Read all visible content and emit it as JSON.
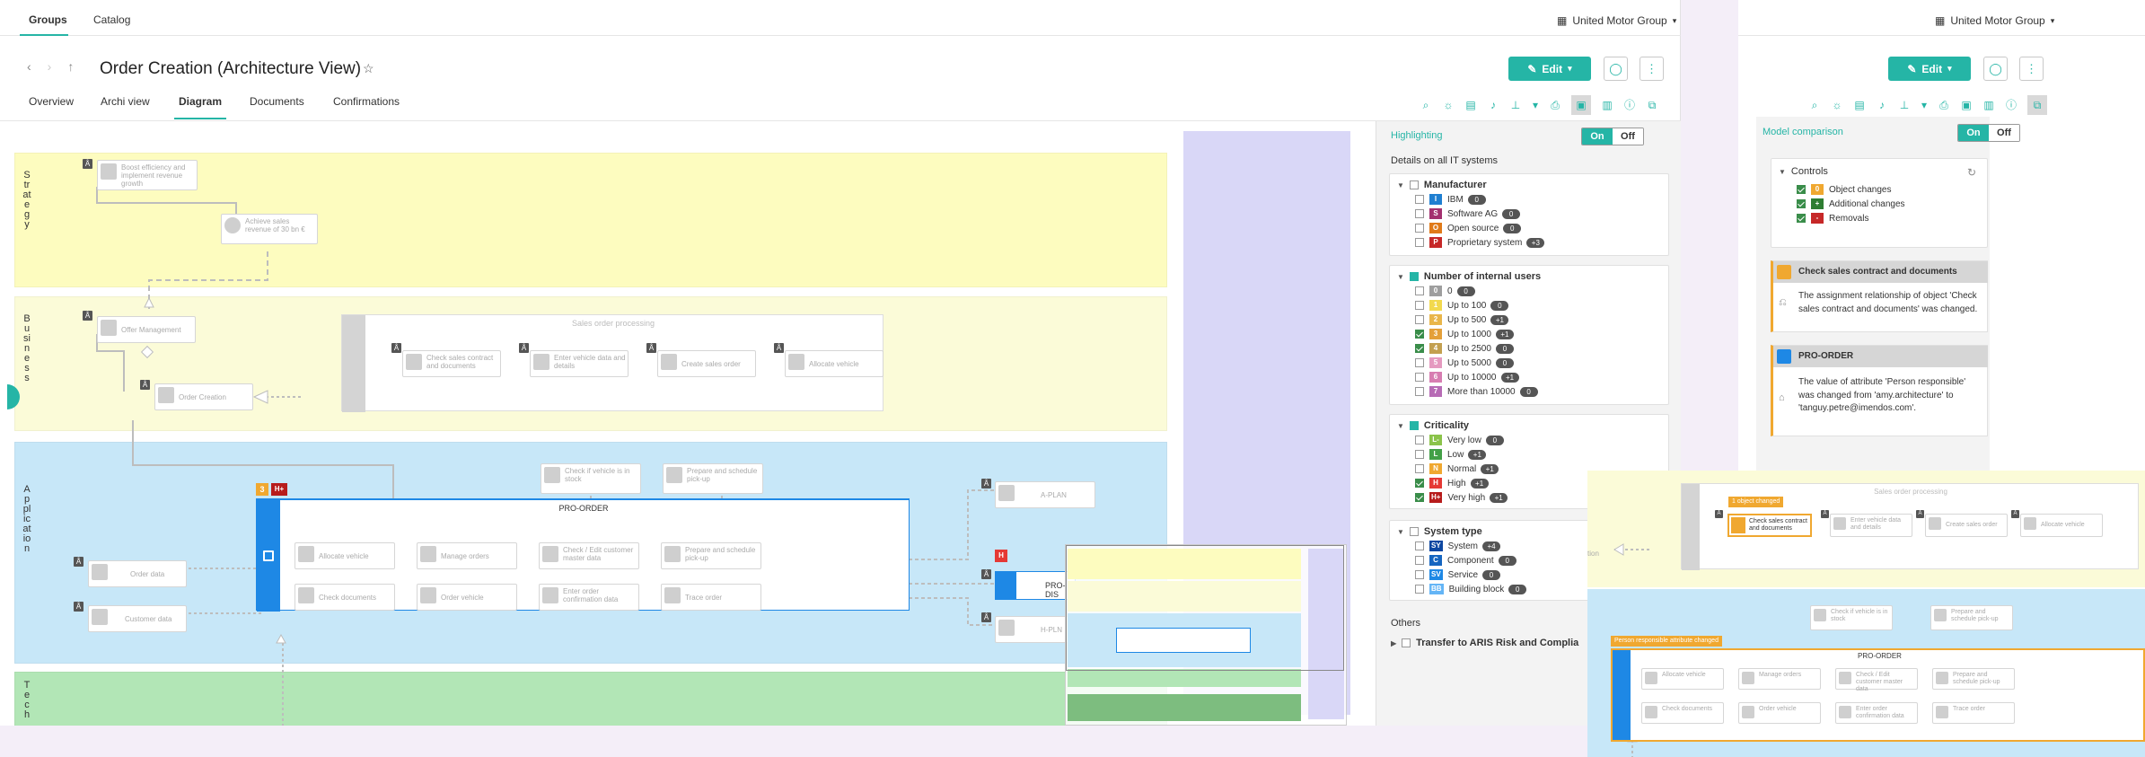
{
  "topnav": {
    "tab_groups": "Groups",
    "tab_catalog": "Catalog",
    "org": "United Motor Group"
  },
  "header": {
    "title": "Order Creation (Architecture View)",
    "edit": "Edit"
  },
  "tabs": [
    "Overview",
    "Archi view",
    "Diagram",
    "Documents",
    "Confirmations"
  ],
  "lanes": {
    "strategy": "Strategy",
    "business": "Business",
    "application": "Application",
    "tech": "Tech"
  },
  "diagram": {
    "strategy_nodes": [
      "Boost efficiency and implement revenue growth",
      "Achieve sales revenue of 30 bn €"
    ],
    "business_nodes": {
      "offer": "Offer Management",
      "order": "Order Creation",
      "group": "Sales order processing",
      "steps": [
        "Check sales contract and documents",
        "Enter vehicle data and details",
        "Create sales order",
        "Allocate vehicle"
      ]
    },
    "app_top": [
      "Check if vehicle is in stock",
      "Prepare and schedule pick-up"
    ],
    "app_left": [
      "Order data",
      "Customer data"
    ],
    "proorder": {
      "title": "PRO-ORDER",
      "badge_num": "3",
      "badge_h": "H+",
      "row1": [
        "Allocate vehicle",
        "Manage orders",
        "Check / Edit customer master data",
        "Prepare and schedule pick-up"
      ],
      "row2": [
        "Check documents",
        "Order vehicle",
        "Enter order confirmation data",
        "Trace order"
      ]
    },
    "app_right": [
      "A-PLAN",
      "PRO-DIS",
      "H-PLN"
    ],
    "h_badge": "H"
  },
  "highlight": {
    "title": "Highlighting",
    "on": "On",
    "off": "Off",
    "details": "Details on all IT systems",
    "manufacturer": {
      "title": "Manufacturer",
      "items": [
        {
          "code": "I",
          "color": "#1f7fd1",
          "label": "IBM",
          "count": "0"
        },
        {
          "code": "S",
          "color": "#a3306f",
          "label": "Software AG",
          "count": "0"
        },
        {
          "code": "O",
          "color": "#e07a19",
          "label": "Open source",
          "count": "0"
        },
        {
          "code": "P",
          "color": "#c62828",
          "label": "Proprietary system",
          "count": "+3"
        }
      ]
    },
    "users": {
      "title": "Number of internal users",
      "items": [
        {
          "code": "0",
          "color": "#9e9e9e",
          "label": "0",
          "count": "0",
          "checked": false
        },
        {
          "code": "1",
          "color": "#f2d94e",
          "label": "Up to 100",
          "count": "0",
          "checked": false
        },
        {
          "code": "2",
          "color": "#e9b64a",
          "label": "Up to 500",
          "count": "+1",
          "checked": false
        },
        {
          "code": "3",
          "color": "#e4a03a",
          "label": "Up to 1000",
          "count": "+1",
          "checked": true
        },
        {
          "code": "4",
          "color": "#c3a050",
          "label": "Up to 2500",
          "count": "0",
          "checked": true
        },
        {
          "code": "5",
          "color": "#e59ac0",
          "label": "Up to 5000",
          "count": "0",
          "checked": false
        },
        {
          "code": "6",
          "color": "#d77db1",
          "label": "Up to 10000",
          "count": "+1",
          "checked": false
        },
        {
          "code": "7",
          "color": "#b76bb5",
          "label": "More than 10000",
          "count": "0",
          "checked": false
        }
      ]
    },
    "criticality": {
      "title": "Criticality",
      "items": [
        {
          "code": "L-",
          "color": "#8bc34a",
          "label": "Very low",
          "count": "0",
          "checked": false
        },
        {
          "code": "L",
          "color": "#43a047",
          "label": "Low",
          "count": "+1",
          "checked": false
        },
        {
          "code": "N",
          "color": "#f0a830",
          "label": "Normal",
          "count": "+1",
          "checked": false
        },
        {
          "code": "H",
          "color": "#e53935",
          "label": "High",
          "count": "+1",
          "checked": true
        },
        {
          "code": "H+",
          "color": "#b71c1c",
          "label": "Very high",
          "count": "+1",
          "checked": true
        }
      ]
    },
    "systype": {
      "title": "System type",
      "items": [
        {
          "code": "SY",
          "color": "#0d47a1",
          "label": "System",
          "count": "+4"
        },
        {
          "code": "C",
          "color": "#1565c0",
          "label": "Component",
          "count": "0"
        },
        {
          "code": "SV",
          "color": "#1e88e5",
          "label": "Service",
          "count": "0"
        },
        {
          "code": "BB",
          "color": "#64b5f6",
          "label": "Building block",
          "count": "0"
        }
      ]
    },
    "others": "Others",
    "transfer": "Transfer to ARIS Risk and Complia"
  },
  "compare": {
    "title": "Model comparison",
    "on": "On",
    "off": "Off",
    "controls": "Controls",
    "items": [
      {
        "code": "0",
        "color": "#f0a830",
        "label": "Object changes"
      },
      {
        "code": "+",
        "color": "#2e7d32",
        "label": "Additional changes"
      },
      {
        "code": "-",
        "color": "#c62828",
        "label": "Removals"
      }
    ],
    "card1_title": "Check sales contract and documents",
    "card1_text": "The assignment relationship of object 'Check sales contract and documents' was changed.",
    "card2_title": "PRO-ORDER",
    "card2_text": "The value of attribute 'Person responsible' was changed from 'amy.architecture' to 'tanguy.petre@imendos.com'."
  },
  "overlay": {
    "group": "Sales order processing",
    "badge": "1 object changed",
    "highlighted": "Check sales contract and documents",
    "steps": [
      "Enter vehicle data and details",
      "Create sales order",
      "Allocate vehicle"
    ],
    "app_top": [
      "Check if vehicle is in stock",
      "Prepare and schedule pick-up"
    ],
    "person_badge": "Person responsible attribute changed",
    "proorder": "PRO-ORDER",
    "row1": [
      "Allocate vehicle",
      "Manage orders",
      "Check / Edit customer master data",
      "Prepare and schedule pick-up"
    ],
    "row2": [
      "Check documents",
      "Order vehicle",
      "Enter order confirmation data",
      "Trace order"
    ],
    "cut": "tion"
  },
  "colors": {
    "accent": "#25b5a6",
    "strategy": "#fdfcbf",
    "business": "#fbfbd8",
    "application": "#c7e7f8",
    "tech": "#b2e6b6"
  }
}
